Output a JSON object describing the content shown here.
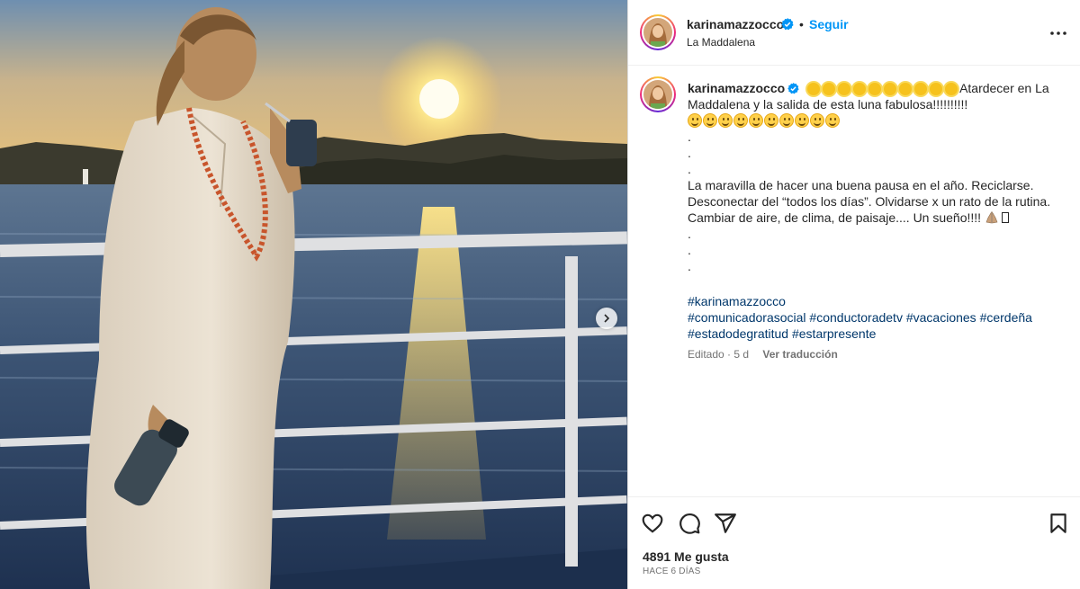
{
  "post": {
    "username": "karinamazzocco",
    "follow_label": "Seguir",
    "separator": "•",
    "location": "La Maddalena",
    "caption": {
      "line1_text": "Atardecer en La Maddalena y la salida de esta luna fabulosa!!!!!!!!!!",
      "dot": ".",
      "paragraph": "La maravilla de hacer una buena pausa en el año. Reciclarse. Desconectar del “todos los días”. Olvidarse x un rato de la rutina. Cambiar de aire, de clima, de paisaje.... Un sueño!!!!"
    },
    "hashtags": [
      "#karinamazzocco",
      "#comunicadorasocial",
      "#conductoradetv",
      "#vacaciones",
      "#cerdeña",
      "#estadodegratitud",
      "#estarpresente"
    ],
    "edited_label": "Editado",
    "age_short": "5 d",
    "translate_label": "Ver traducción",
    "likes_label": "4891 Me gusta",
    "time_ago": "HACE 6 DÍAS"
  },
  "icons": {
    "verified": "verified-badge-icon",
    "more": "more-options-icon",
    "like": "heart-icon",
    "comment": "comment-icon",
    "share": "share-icon",
    "save": "bookmark-icon",
    "next": "chevron-right-icon"
  },
  "colors": {
    "link_blue": "#0095f6",
    "hashtag": "#00376b",
    "verified": "#0095f6",
    "muted": "#737373"
  }
}
